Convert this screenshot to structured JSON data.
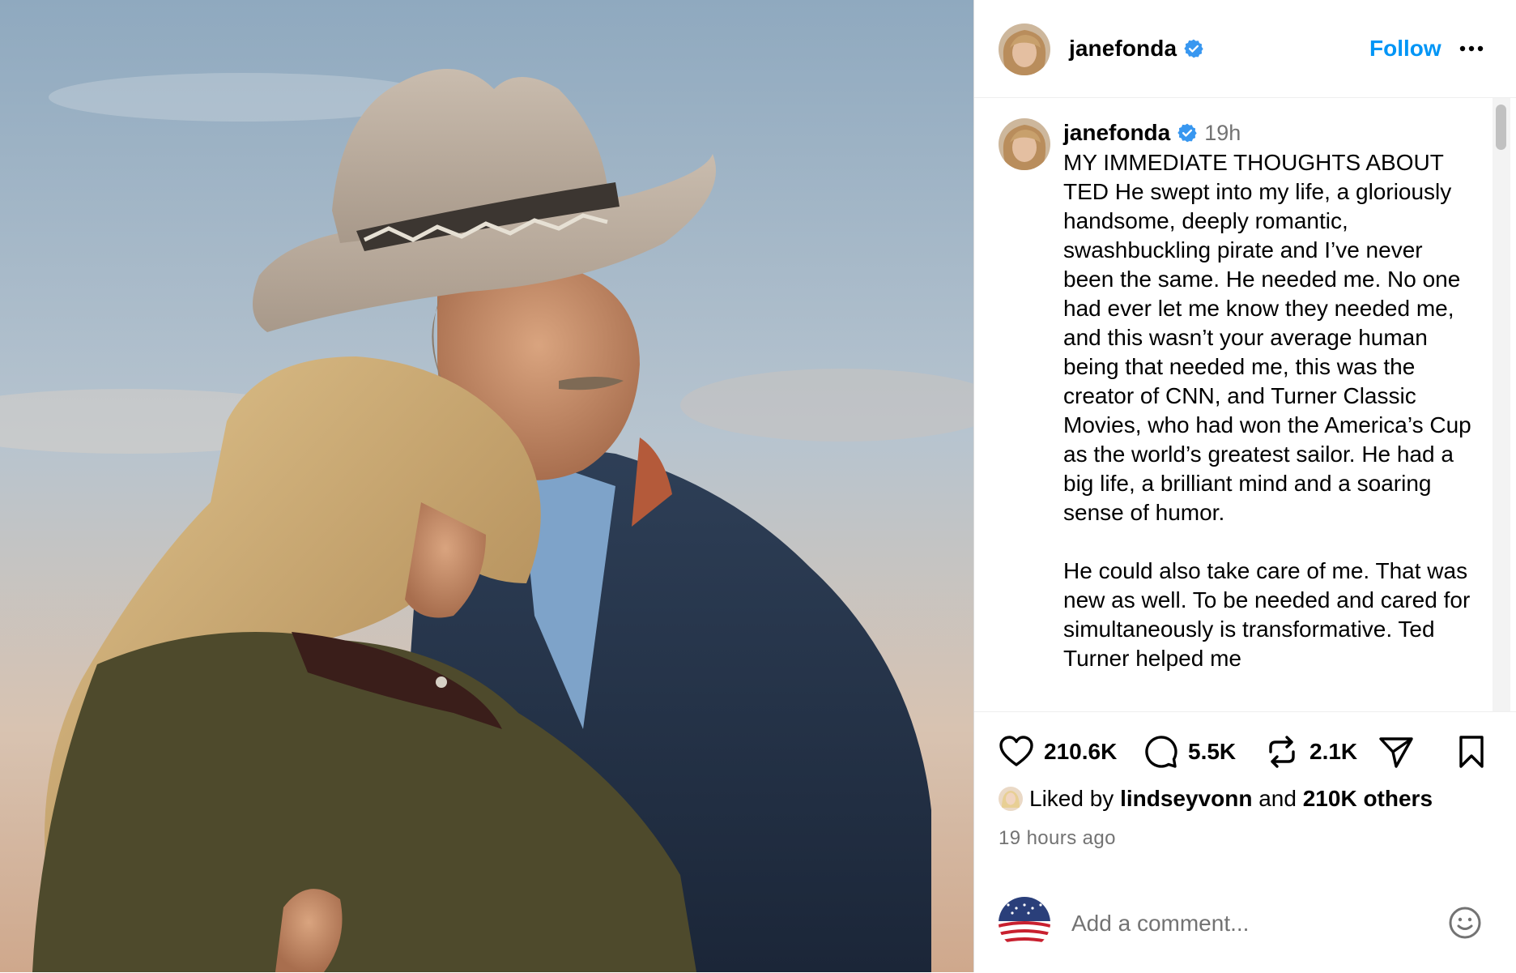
{
  "post": {
    "username": "janefonda",
    "verified": true,
    "follow_label": "Follow",
    "more_icon": "more-horizontal-icon"
  },
  "caption": {
    "username": "janefonda",
    "time": "19h",
    "paragraphs": [
      "MY IMMEDIATE THOUGHTS ABOUT TED He swept into my life, a gloriously handsome, deeply romantic, swashbuckling pirate and I’ve never been the same. He needed me. No one had ever let me know they needed me, and this wasn’t your average human being that needed me, this was the creator of CNN, and Turner Classic Movies, who had won the America’s Cup as the world’s greatest sailor. He had a big life, a brilliant mind and a soaring sense of humor.",
      "He could also take care of me. That was new as well. To be needed and cared for simultaneously is transformative. Ted Turner helped me"
    ]
  },
  "actions": {
    "likes": "210.6K",
    "comments": "5.5K",
    "reposts": "2.1K"
  },
  "liked_by": {
    "prefix": "Liked by",
    "user": "lindseyvonn",
    "middle": "and",
    "others": "210K others"
  },
  "timestamp": "19 hours ago",
  "comment": {
    "placeholder": "Add a comment..."
  },
  "colors": {
    "accent": "#0095f6",
    "verified": "#3897f0",
    "muted": "#737373"
  }
}
